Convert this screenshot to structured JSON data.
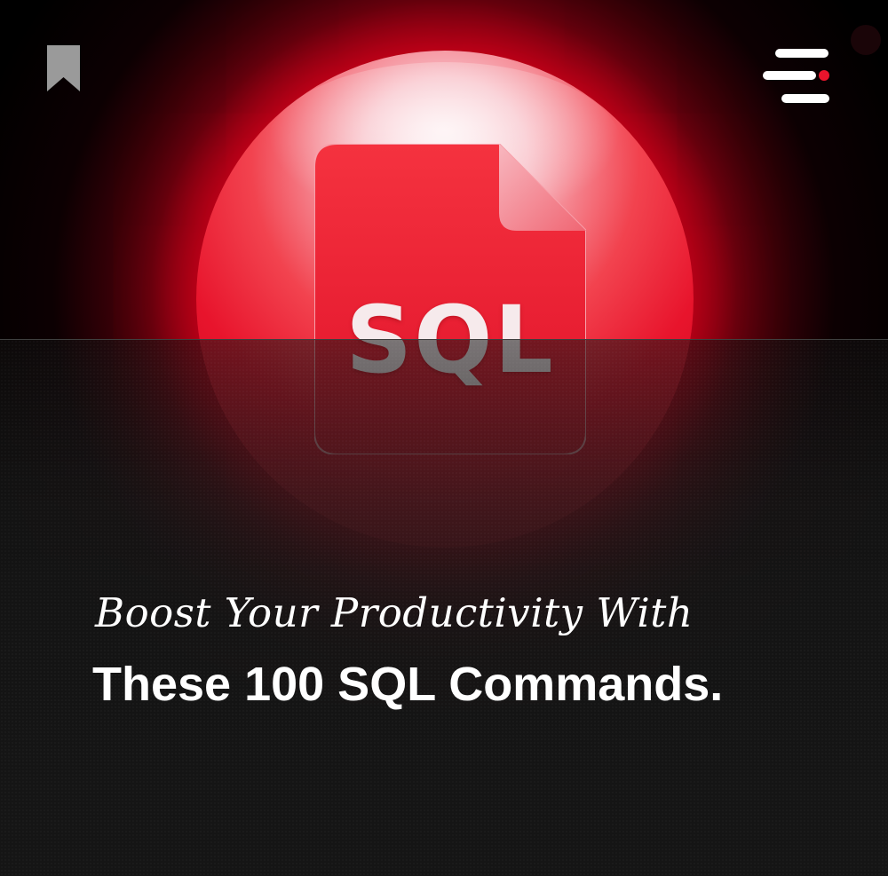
{
  "brand": {
    "accent": "#e8142c",
    "background": "#000000",
    "text": "#ffffff"
  },
  "icons": {
    "bookmark": "bookmark-icon",
    "menu": "menu-icon",
    "document": "sql-file-icon"
  },
  "hero": {
    "file_label": "SQL"
  },
  "headline": {
    "line1": "Boost Your Productivity With",
    "line2": "These 100 SQL Commands."
  }
}
